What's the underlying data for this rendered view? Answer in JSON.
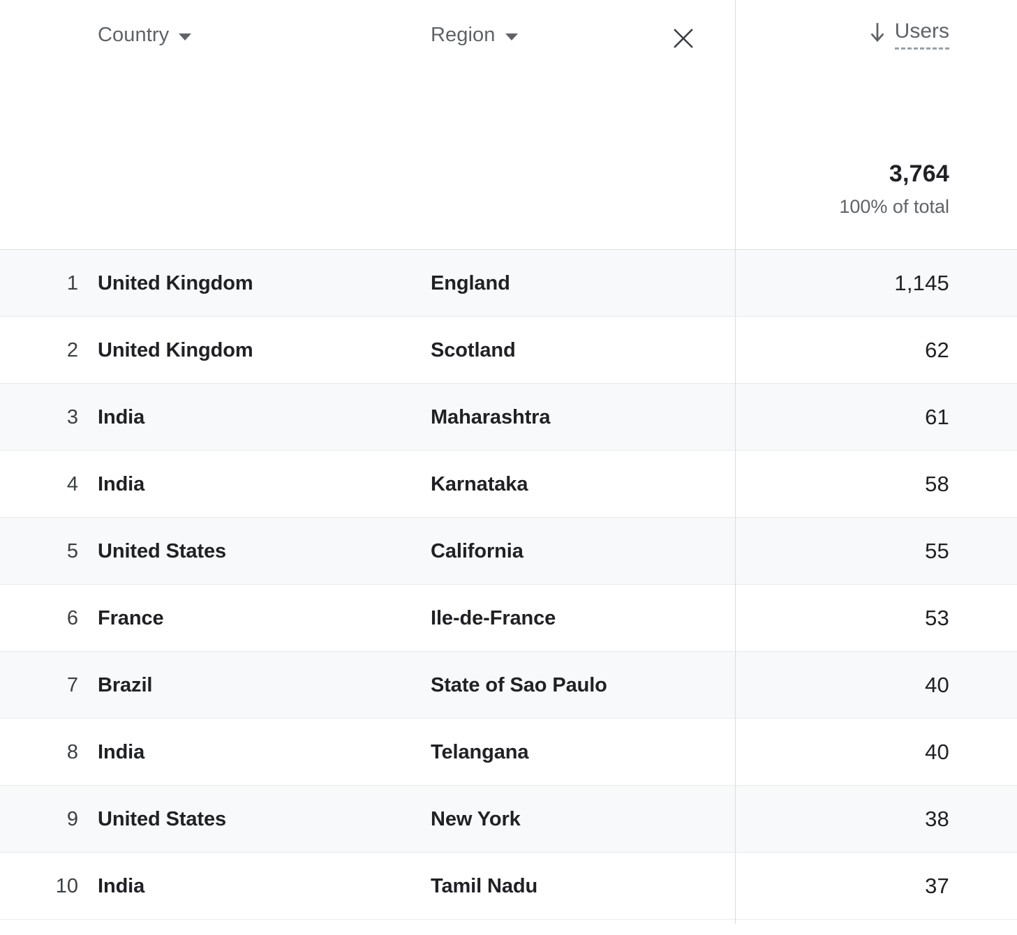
{
  "table": {
    "columns": {
      "rank_label": "",
      "country": {
        "label": "Country",
        "dropdown_icon": "chevron-down-icon"
      },
      "region": {
        "label": "Region",
        "dropdown_icon": "chevron-down-icon",
        "remove_icon": "close-icon"
      },
      "metric": {
        "label": "Users",
        "sort_icon": "arrow-down-icon",
        "sort_direction": "descending"
      }
    },
    "totals": {
      "value": "3,764",
      "subtitle": "100% of total"
    },
    "rows": [
      {
        "rank": "1",
        "country": "United Kingdom",
        "region": "England",
        "users": "1,145"
      },
      {
        "rank": "2",
        "country": "United Kingdom",
        "region": "Scotland",
        "users": "62"
      },
      {
        "rank": "3",
        "country": "India",
        "region": "Maharashtra",
        "users": "61"
      },
      {
        "rank": "4",
        "country": "India",
        "region": "Karnataka",
        "users": "58"
      },
      {
        "rank": "5",
        "country": "United States",
        "region": "California",
        "users": "55"
      },
      {
        "rank": "6",
        "country": "France",
        "region": "Ile-de-France",
        "users": "53"
      },
      {
        "rank": "7",
        "country": "Brazil",
        "region": "State of Sao Paulo",
        "users": "40"
      },
      {
        "rank": "8",
        "country": "India",
        "region": "Telangana",
        "users": "40"
      },
      {
        "rank": "9",
        "country": "United States",
        "region": "New York",
        "users": "38"
      },
      {
        "rank": "10",
        "country": "India",
        "region": "Tamil Nadu",
        "users": "37"
      }
    ]
  },
  "colors": {
    "row_shaded_bg": "#f7f9fa",
    "row_bg": "#ffffff",
    "text_primary": "#202124",
    "text_secondary": "#5f6368",
    "border": "#e8eaed",
    "divider": "#dadce0"
  }
}
